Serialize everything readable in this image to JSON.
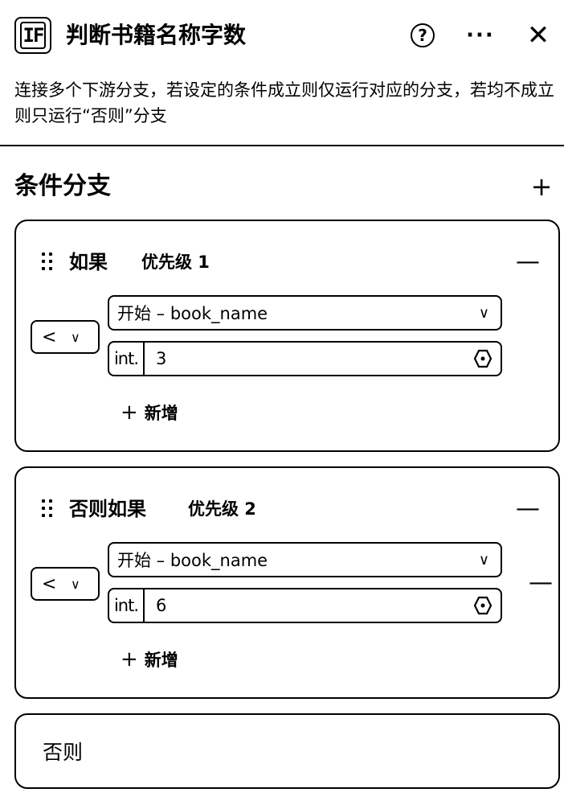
{
  "header": {
    "icon_label": "IF",
    "title": "判断书籍名称字数",
    "help_symbol": "?",
    "more_symbol": "···",
    "close_symbol": "✕",
    "description": "连接多个下游分支，若设定的条件成立则仅运行对应的分支，若均不成立则只运行“否则”分支"
  },
  "section": {
    "title": "条件分支",
    "add_symbol": "+"
  },
  "branches": [
    {
      "name": "如果",
      "priority": "优先级 1",
      "minus": "—",
      "operator": "<",
      "left_operand": "开始 – book_name",
      "right_type": "int.",
      "right_value": "3",
      "add_label": "新增"
    },
    {
      "name": "否则如果",
      "priority": "优先级 2",
      "minus": "—",
      "operator": "<",
      "left_operand": "开始 – book_name",
      "right_type": "int.",
      "right_value": "6",
      "add_label": "新增",
      "condition_minus": "—"
    }
  ],
  "else_branch": {
    "name": "否则"
  },
  "icons": {
    "chevron": "chevron-down-icon",
    "reference": "variable-ref-icon",
    "drag": "drag-handle-icon"
  }
}
